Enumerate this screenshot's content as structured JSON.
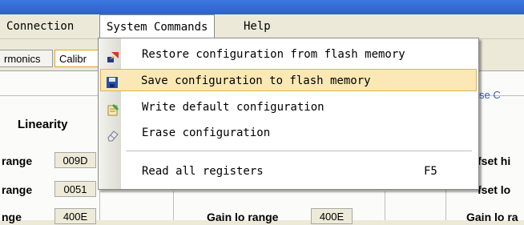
{
  "menubar": {
    "items": [
      "Connection",
      "System Commands",
      "Help"
    ]
  },
  "tabs": [
    "rmonics",
    "Calibr"
  ],
  "panel": {
    "heading": "Linearity",
    "phase_link": "se C",
    "left_rows": [
      {
        "label": "range",
        "value": "009D"
      },
      {
        "label": "range",
        "value": "0051"
      },
      {
        "label": "nge",
        "value": "400E"
      }
    ],
    "mid_rows": [
      {
        "label": "Gain lo range",
        "value": "400E"
      }
    ],
    "right_rows": [
      {
        "label": "fset hi"
      },
      {
        "label": "fset lo"
      },
      {
        "label": "Gain lo ra"
      }
    ]
  },
  "dropdown": {
    "items": [
      {
        "label": "Restore configuration from flash memory",
        "icon": "restore-icon",
        "shortcut": ""
      },
      {
        "label": "Save configuration to flash memory",
        "icon": "floppy-disk-icon",
        "shortcut": ""
      },
      {
        "label": "Write default configuration",
        "icon": "write-notepad-icon",
        "shortcut": ""
      },
      {
        "label": "Erase configuration",
        "icon": "eraser-icon",
        "shortcut": ""
      },
      {
        "label": "Read all registers",
        "icon": "",
        "shortcut": "F5"
      }
    ],
    "highlight_color": "#fbe8b4"
  }
}
